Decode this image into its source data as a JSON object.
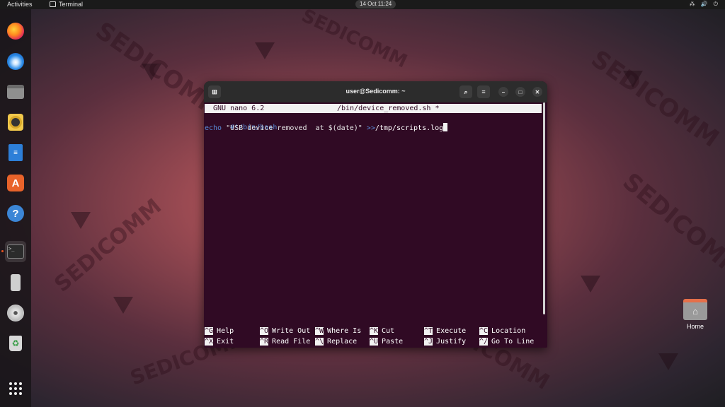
{
  "topbar": {
    "activities": "Activities",
    "app_name": "Terminal",
    "clock": "14 Oct  11:24",
    "tray": [
      "⁂",
      "🔊",
      "⏻"
    ]
  },
  "dock": {
    "items": [
      {
        "name": "firefox-icon"
      },
      {
        "name": "thunderbird-icon"
      },
      {
        "name": "files-icon"
      },
      {
        "name": "rhythmbox-icon"
      },
      {
        "name": "writer-icon"
      },
      {
        "name": "software-icon",
        "glyph": "A"
      },
      {
        "name": "help-icon",
        "glyph": "?"
      },
      {
        "name": "terminal-icon",
        "glyph": ">_"
      },
      {
        "name": "usb-icon"
      },
      {
        "name": "cd-icon"
      },
      {
        "name": "trash-icon",
        "glyph": "♻"
      },
      {
        "name": "apps-grid-icon"
      }
    ]
  },
  "desktop": {
    "home_label": "Home"
  },
  "watermark": {
    "text": "SEDICOMM"
  },
  "window": {
    "title": "user@Sedicomm: ~",
    "nano_version": "GNU nano 6.2",
    "file_name": "/bin/device_removed.sh *",
    "lines": {
      "shebang": "#!/bin/bash",
      "echo_kw": "echo",
      "echo_str": " \"USB device removed  at $(date)\" ",
      "echo_op": ">>",
      "echo_path": "/tmp/scripts.log"
    },
    "shortcuts": [
      {
        "key": "^G",
        "label": "Help"
      },
      {
        "key": "^O",
        "label": "Write Out"
      },
      {
        "key": "^W",
        "label": "Where Is"
      },
      {
        "key": "^K",
        "label": "Cut"
      },
      {
        "key": "^T",
        "label": "Execute"
      },
      {
        "key": "^C",
        "label": "Location"
      },
      {
        "key": "^X",
        "label": "Exit"
      },
      {
        "key": "^R",
        "label": "Read File"
      },
      {
        "key": "^\\",
        "label": "Replace"
      },
      {
        "key": "^U",
        "label": "Paste"
      },
      {
        "key": "^J",
        "label": "Justify"
      },
      {
        "key": "^/",
        "label": "Go To Line"
      }
    ]
  }
}
